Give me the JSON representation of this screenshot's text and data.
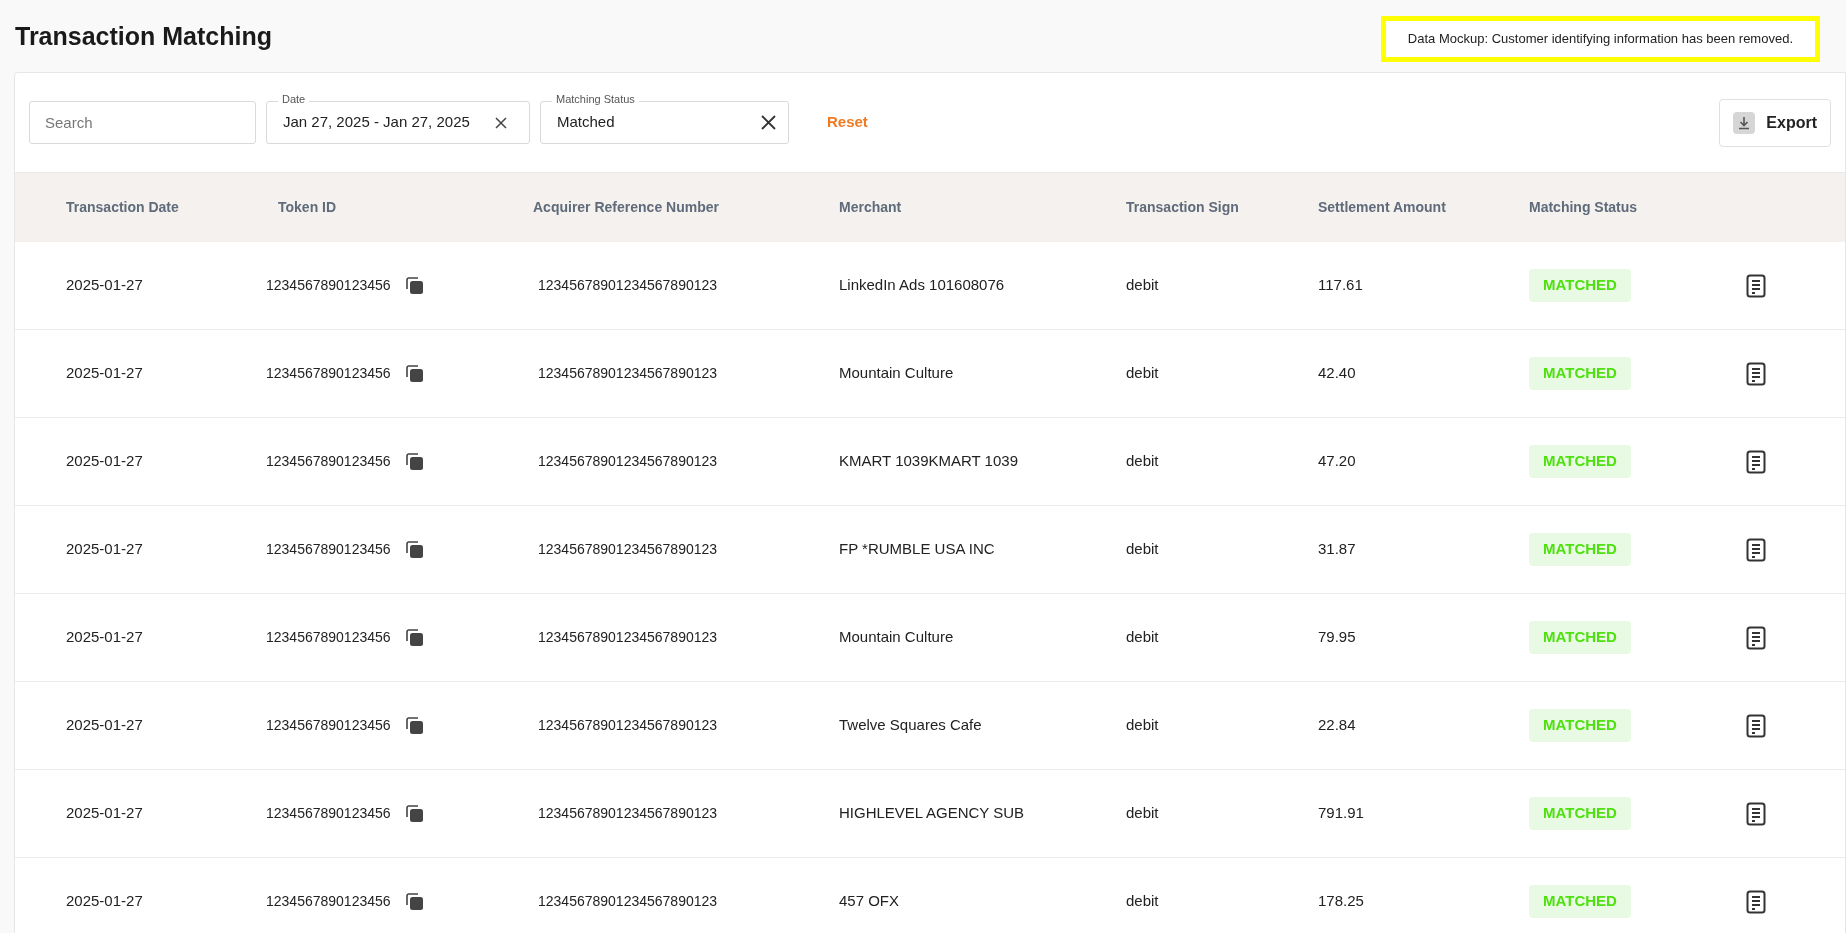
{
  "title": "Transaction Matching",
  "notice": "Data Mockup: Customer identifying information has been removed.",
  "filters": {
    "search": {
      "placeholder": "Search"
    },
    "date": {
      "label": "Date",
      "value": "Jan 27, 2025 - Jan 27, 2025"
    },
    "status": {
      "label": "Matching Status",
      "value": "Matched"
    },
    "reset": "Reset",
    "export": "Export"
  },
  "table": {
    "columns": [
      "Transaction Date",
      "Token ID",
      "Acquirer Reference Number",
      "Merchant",
      "Transaction Sign",
      "Settlement Amount",
      "Matching Status"
    ],
    "rows": [
      {
        "date": "2025-01-27",
        "token": "1234567890123456",
        "arn": "12345678901234567890123",
        "merchant": "LinkedIn Ads 101608076",
        "sign": "debit",
        "amount": "117.61",
        "status": "MATCHED"
      },
      {
        "date": "2025-01-27",
        "token": "1234567890123456",
        "arn": "12345678901234567890123",
        "merchant": "Mountain Culture",
        "sign": "debit",
        "amount": "42.40",
        "status": "MATCHED"
      },
      {
        "date": "2025-01-27",
        "token": "1234567890123456",
        "arn": "12345678901234567890123",
        "merchant": "KMART 1039KMART 1039",
        "sign": "debit",
        "amount": "47.20",
        "status": "MATCHED"
      },
      {
        "date": "2025-01-27",
        "token": "1234567890123456",
        "arn": "12345678901234567890123",
        "merchant": "FP *RUMBLE USA INC",
        "sign": "debit",
        "amount": "31.87",
        "status": "MATCHED"
      },
      {
        "date": "2025-01-27",
        "token": "1234567890123456",
        "arn": "12345678901234567890123",
        "merchant": "Mountain Culture",
        "sign": "debit",
        "amount": "79.95",
        "status": "MATCHED"
      },
      {
        "date": "2025-01-27",
        "token": "1234567890123456",
        "arn": "12345678901234567890123",
        "merchant": "Twelve Squares Cafe",
        "sign": "debit",
        "amount": "22.84",
        "status": "MATCHED"
      },
      {
        "date": "2025-01-27",
        "token": "1234567890123456",
        "arn": "12345678901234567890123",
        "merchant": "HIGHLEVEL AGENCY SUB",
        "sign": "debit",
        "amount": "791.91",
        "status": "MATCHED"
      },
      {
        "date": "2025-01-27",
        "token": "1234567890123456",
        "arn": "12345678901234567890123",
        "merchant": "457 OFX",
        "sign": "debit",
        "amount": "178.25",
        "status": "MATCHED"
      }
    ]
  }
}
